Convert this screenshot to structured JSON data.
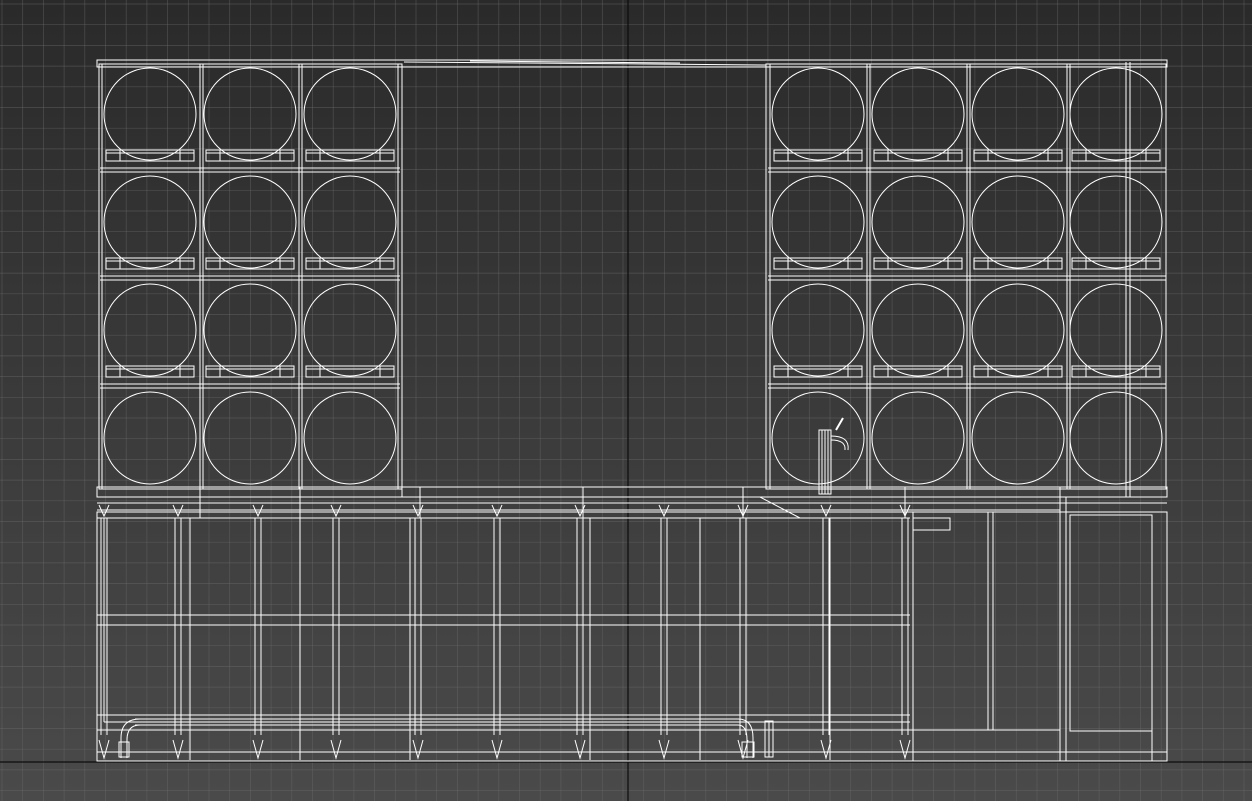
{
  "viewport": {
    "background_top": "#2a2a2a",
    "background_bottom": "#4a4a4a",
    "grid_color": "#6a6a6a",
    "axis_color": "#0d0d0d",
    "wire_color": "#ffffff"
  },
  "model": {
    "left_rack": {
      "columns": 3,
      "rows": 4
    },
    "right_rack": {
      "columns": 4,
      "rows": 4
    },
    "tap": "beer-tap",
    "cabinet_doors": 9
  }
}
